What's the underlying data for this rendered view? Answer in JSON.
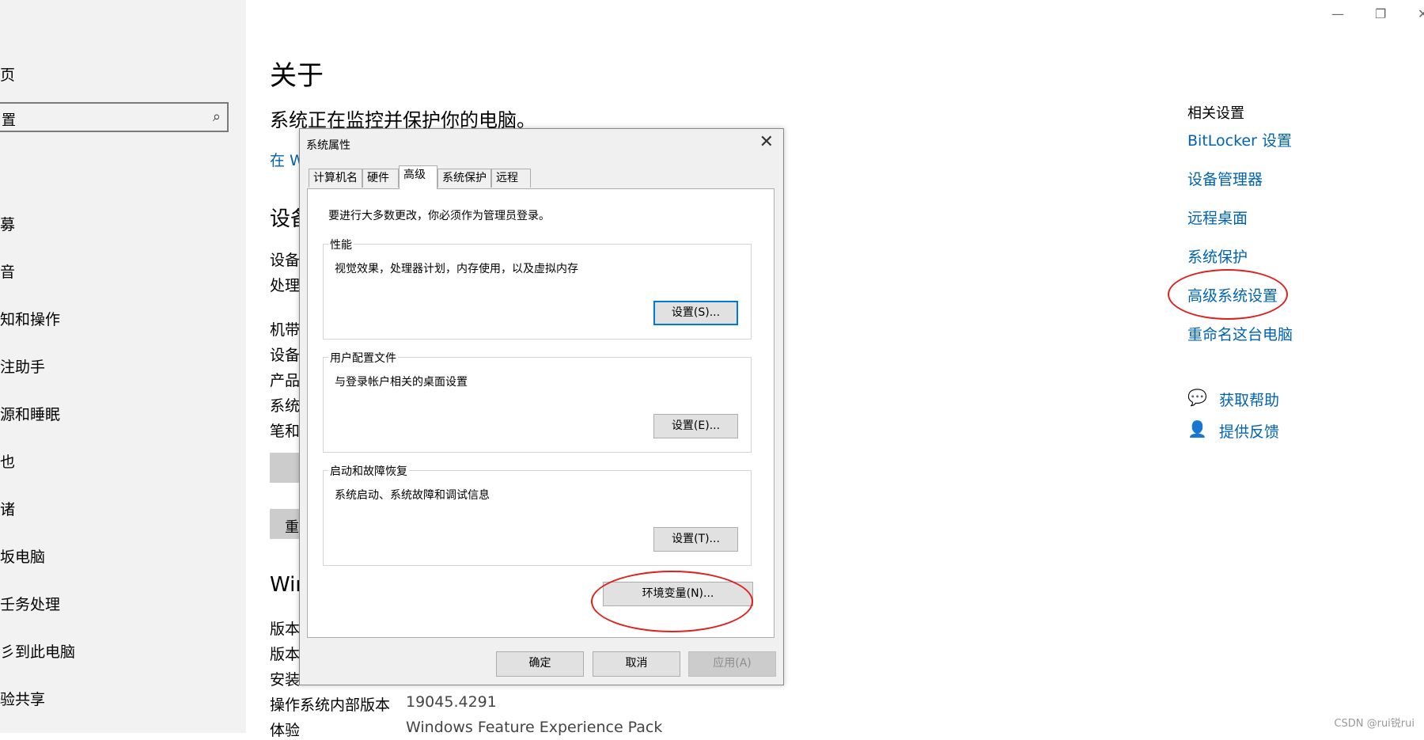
{
  "left_nav": {
    "item_home": "页",
    "search_text": "置",
    "items": [
      "募",
      "音",
      "知和操作",
      "注助手",
      "源和睡眠",
      "也",
      "诸",
      "坂电脑",
      "壬务处理",
      "彡到此电脑",
      "验共享"
    ]
  },
  "main": {
    "page_title": "关于",
    "status": "系统正在监控并保护你的电脑。",
    "link_partial": "在 W",
    "section_device": "设备",
    "device_labels": [
      "设备",
      "处理",
      "机带",
      "设备",
      "产品",
      "系统",
      "笔和"
    ],
    "btn_rename_partial": "重",
    "section_windows": "Win",
    "win_labels": [
      "版本",
      "版本",
      "安装"
    ],
    "os_build_label": "操作系统内部版本",
    "os_build_value": "19045.4291",
    "experience_label": "体验",
    "experience_value": "Windows Feature Experience Pack"
  },
  "related": {
    "heading": "相关设置",
    "links": [
      "BitLocker 设置",
      "设备管理器",
      "远程桌面",
      "系统保护",
      "高级系统设置",
      "重命名这台电脑"
    ],
    "help": "获取帮助",
    "feedback": "提供反馈"
  },
  "dialog": {
    "title": "系统属性",
    "tabs": [
      "计算机名",
      "硬件",
      "高级",
      "系统保护",
      "远程"
    ],
    "admin_note": "要进行大多数更改，你必须作为管理员登录。",
    "performance": {
      "legend": "性能",
      "desc": "视觉效果，处理器计划，内存使用，以及虚拟内存",
      "button": "设置(S)..."
    },
    "profiles": {
      "legend": "用户配置文件",
      "desc": "与登录帐户相关的桌面设置",
      "button": "设置(E)..."
    },
    "startup": {
      "legend": "启动和故障恢复",
      "desc": "系统启动、系统故障和调试信息",
      "button": "设置(T)..."
    },
    "env_button": "环境变量(N)...",
    "ok": "确定",
    "cancel": "取消",
    "apply": "应用(A)"
  },
  "watermark": "CSDN @rui锐rui",
  "colors": {
    "link": "#0063b1",
    "highlight_ellipse": "#e0201c",
    "focus_border": "#0078d7"
  }
}
